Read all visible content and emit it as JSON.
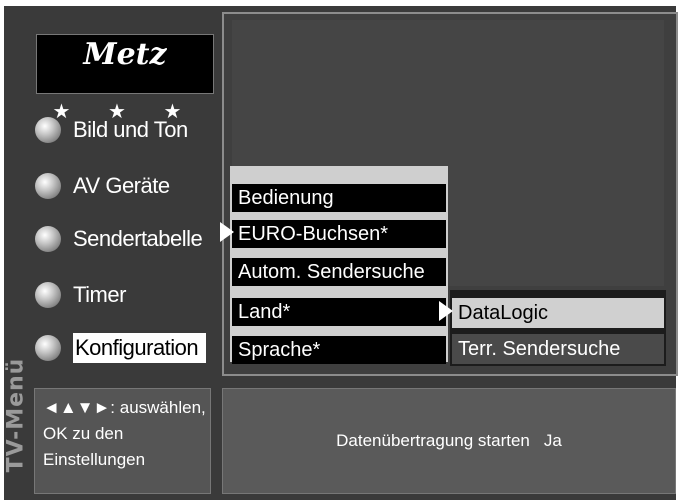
{
  "side_label": "TV-Menü",
  "logo": {
    "text": "Metz",
    "stars": "★ ★ ★"
  },
  "main_menu": {
    "items": [
      {
        "label": "Bild und Ton"
      },
      {
        "label": "AV Geräte"
      },
      {
        "label": "Sendertabelle"
      },
      {
        "label": "Timer"
      },
      {
        "label": "Konfiguration"
      }
    ],
    "selected": "Konfiguration"
  },
  "submenu": {
    "items": [
      {
        "label": "Bedienung"
      },
      {
        "label": "EURO-Buchsen*"
      },
      {
        "label": "Autom. Sendersuche"
      },
      {
        "label": "Land*"
      },
      {
        "label": "Sprache*"
      }
    ]
  },
  "sub_submenu": {
    "items": [
      {
        "label": "DataLogic"
      },
      {
        "label": "Terr. Sendersuche"
      }
    ],
    "selected": "DataLogic"
  },
  "help": {
    "line1": "◄▲▼►: auswählen,",
    "line2": "OK zu den",
    "line3": "Einstellungen"
  },
  "status": {
    "label": "Datenübertragung starten",
    "value": "Ja"
  }
}
